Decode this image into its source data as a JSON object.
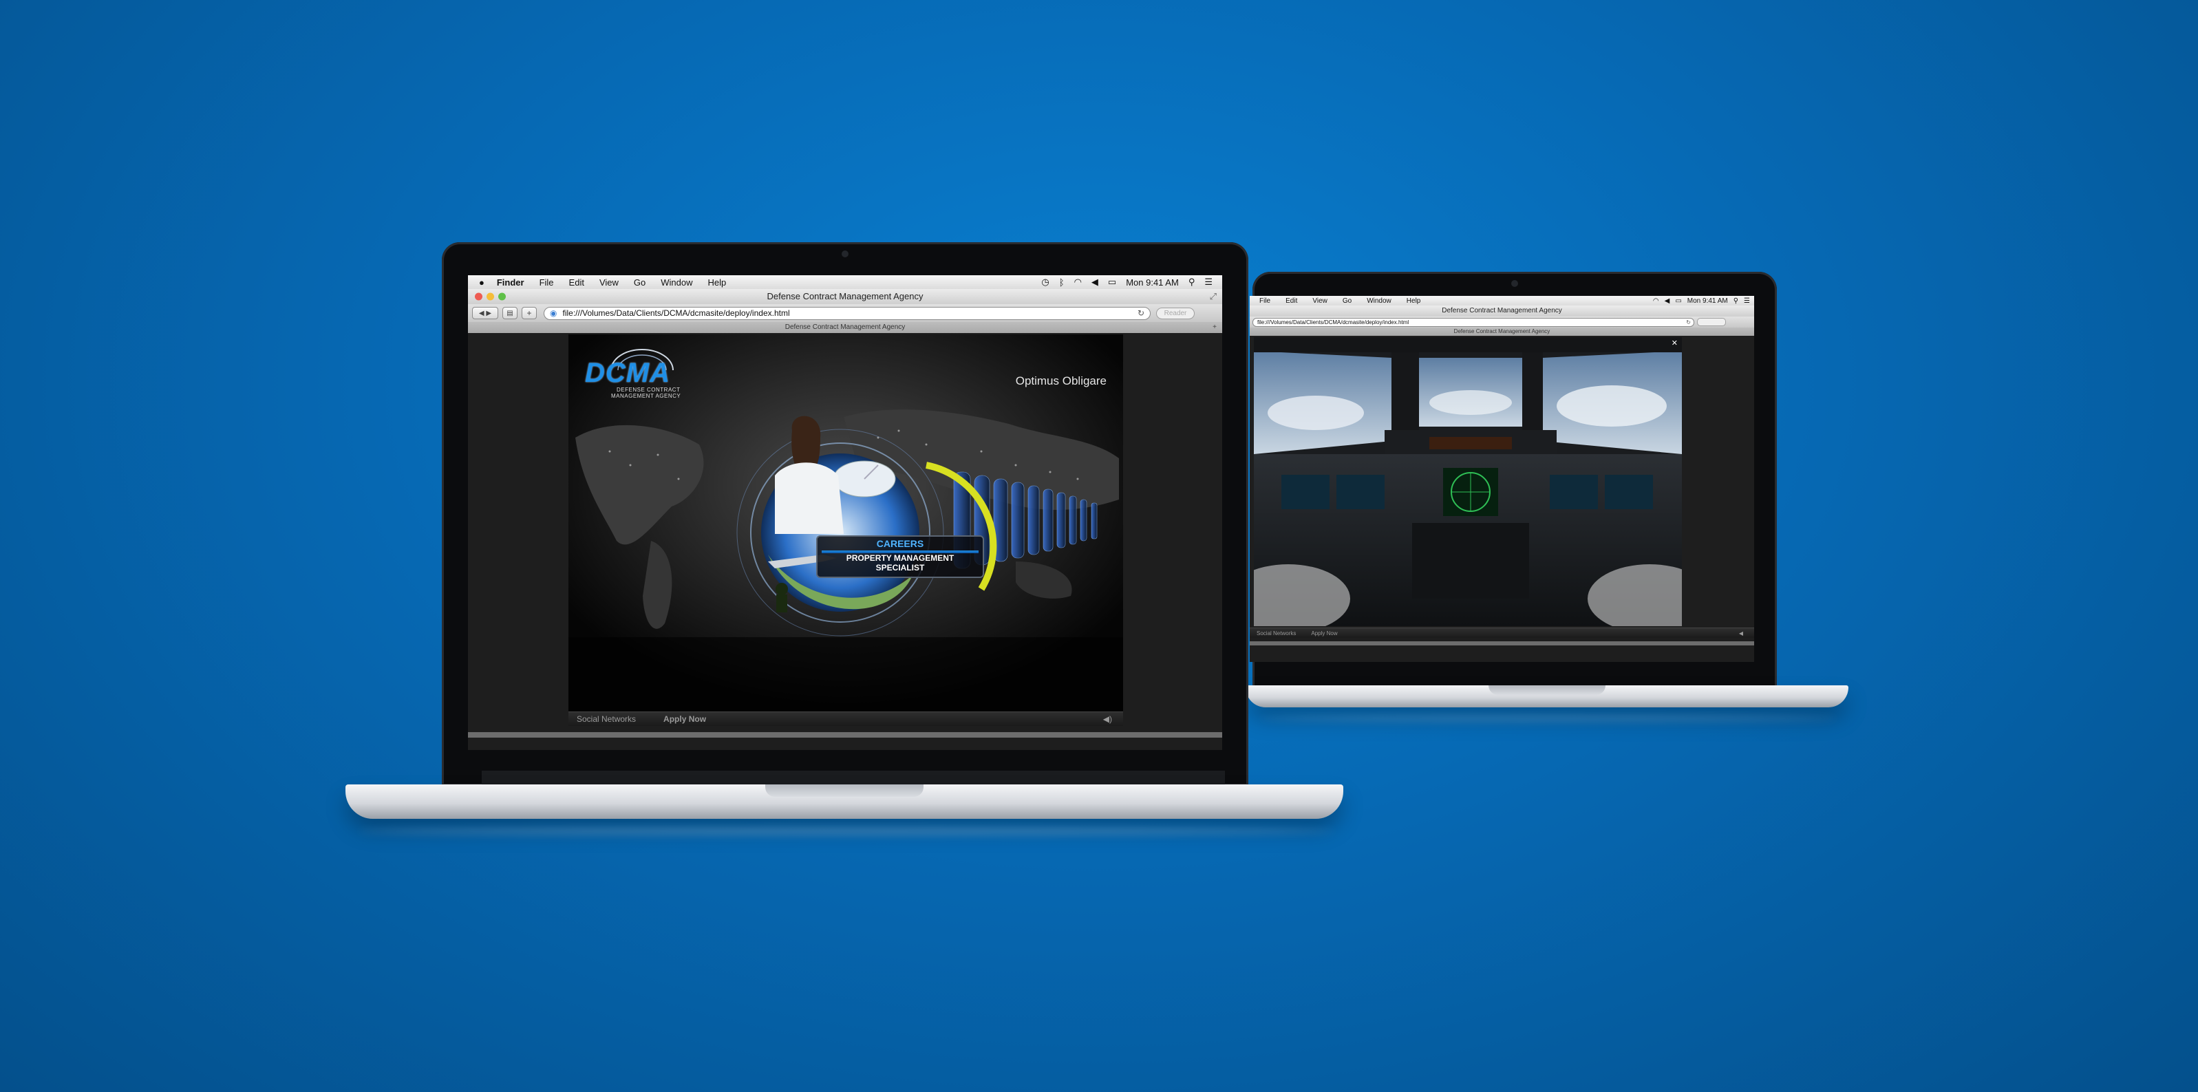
{
  "front": {
    "menubar": {
      "app": "Finder",
      "items": [
        "File",
        "Edit",
        "View",
        "Go",
        "Window",
        "Help"
      ],
      "clock": "Mon 9:41 AM"
    },
    "browser": {
      "window_title": "Defense Contract Management Agency",
      "url": "file:///Volumes/Data/Clients/DCMA/dcmasite/deploy/index.html",
      "reader_label": "Reader",
      "tab_title": "Defense Contract Management Agency"
    },
    "site": {
      "logo_text": "DCMA",
      "logo_sub_1": "DEFENSE CONTRACT",
      "logo_sub_2": "MANAGEMENT AGENCY",
      "motto": "Optimus Obligare",
      "panel_heading": "CAREERS",
      "panel_line_1": "PROPERTY MANAGEMENT",
      "panel_line_2": "SPECIALIST",
      "footer_social": "Social Networks",
      "footer_apply": "Apply Now"
    }
  },
  "back": {
    "menubar": {
      "items": [
        "File",
        "Edit",
        "View",
        "Go",
        "Window",
        "Help"
      ],
      "clock": "Mon 9:41 AM"
    },
    "browser": {
      "window_title": "Defense Contract Management Agency",
      "url": "file:///Volumes/Data/Clients/DCMA/dcmasite/deploy/index.html",
      "tab_title": "Defense Contract Management Agency"
    },
    "site": {
      "footer_social": "Social Networks",
      "footer_apply": "Apply Now"
    }
  },
  "icons": {
    "apple": "apple-icon",
    "wifi": "wifi-icon",
    "volume": "speaker-icon",
    "battery": "battery-icon",
    "search": "search-icon",
    "list": "list-icon",
    "expand": "expand-icon"
  },
  "colors": {
    "background": "#0669b4",
    "dcma_blue": "#1f8fe6",
    "panel_heading": "#4fb3ff",
    "yellow_ring": "#d8e021"
  }
}
